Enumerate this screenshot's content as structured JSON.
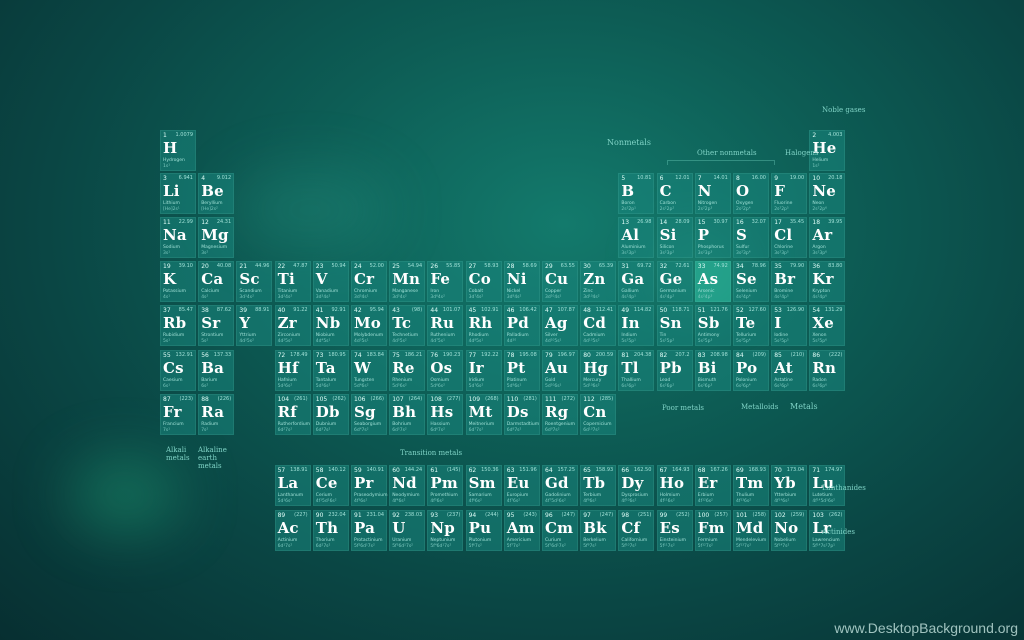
{
  "labels": {
    "nonmetals": "Nonmetals",
    "other_nonmetals": "Other nonmetals",
    "halogens": "Halogens",
    "noble_gases": "Noble gases",
    "transition_metals": "Transition metals",
    "poor_metals": "Poor metals",
    "metalloids": "Metalloids",
    "metals": "Metals",
    "alkali_metals": "Alkali metals",
    "alkaline_earth_metals": "Alkaline earth metals",
    "lanthanides": "Lanthanides",
    "actinides": "Actinides"
  },
  "watermark": "www.DesktopBackground.org",
  "elements": [
    {
      "n": "1",
      "s": "H",
      "name": "Hydrogen",
      "m": "1.0079",
      "c": "1s¹",
      "g": 1,
      "p": 1
    },
    {
      "n": "2",
      "s": "He",
      "name": "Helium",
      "m": "4.003",
      "c": "1s²",
      "g": 18,
      "p": 1
    },
    {
      "n": "3",
      "s": "Li",
      "name": "Lithium",
      "m": "6.941",
      "c": "[He]2s¹",
      "g": 1,
      "p": 2
    },
    {
      "n": "4",
      "s": "Be",
      "name": "Beryllium",
      "m": "9.012",
      "c": "[He]2s²",
      "g": 2,
      "p": 2
    },
    {
      "n": "5",
      "s": "B",
      "name": "Boron",
      "m": "10.81",
      "c": "2s²2p¹",
      "g": 13,
      "p": 2
    },
    {
      "n": "6",
      "s": "C",
      "name": "Carbon",
      "m": "12.01",
      "c": "2s²2p²",
      "g": 14,
      "p": 2
    },
    {
      "n": "7",
      "s": "N",
      "name": "Nitrogen",
      "m": "14.01",
      "c": "2s²2p³",
      "g": 15,
      "p": 2
    },
    {
      "n": "8",
      "s": "O",
      "name": "Oxygen",
      "m": "16.00",
      "c": "2s²2p⁴",
      "g": 16,
      "p": 2
    },
    {
      "n": "9",
      "s": "F",
      "name": "Fluorine",
      "m": "19.00",
      "c": "2s²2p⁵",
      "g": 17,
      "p": 2
    },
    {
      "n": "10",
      "s": "Ne",
      "name": "Neon",
      "m": "20.18",
      "c": "2s²2p⁶",
      "g": 18,
      "p": 2
    },
    {
      "n": "11",
      "s": "Na",
      "name": "Sodium",
      "m": "22.99",
      "c": "3s¹",
      "g": 1,
      "p": 3
    },
    {
      "n": "12",
      "s": "Mg",
      "name": "Magnesium",
      "m": "24.31",
      "c": "3s²",
      "g": 2,
      "p": 3
    },
    {
      "n": "13",
      "s": "Al",
      "name": "Aluminium",
      "m": "26.98",
      "c": "3s²3p¹",
      "g": 13,
      "p": 3
    },
    {
      "n": "14",
      "s": "Si",
      "name": "Silicon",
      "m": "28.09",
      "c": "3s²3p²",
      "g": 14,
      "p": 3
    },
    {
      "n": "15",
      "s": "P",
      "name": "Phosphorus",
      "m": "30.97",
      "c": "3s²3p³",
      "g": 15,
      "p": 3
    },
    {
      "n": "16",
      "s": "S",
      "name": "Sulfur",
      "m": "32.07",
      "c": "3s²3p⁴",
      "g": 16,
      "p": 3
    },
    {
      "n": "17",
      "s": "Cl",
      "name": "Chlorine",
      "m": "35.45",
      "c": "3s²3p⁵",
      "g": 17,
      "p": 3
    },
    {
      "n": "18",
      "s": "Ar",
      "name": "Argon",
      "m": "39.95",
      "c": "3s²3p⁶",
      "g": 18,
      "p": 3
    },
    {
      "n": "19",
      "s": "K",
      "name": "Potassium",
      "m": "39.10",
      "c": "4s¹",
      "g": 1,
      "p": 4
    },
    {
      "n": "20",
      "s": "Ca",
      "name": "Calcium",
      "m": "40.08",
      "c": "4s²",
      "g": 2,
      "p": 4
    },
    {
      "n": "21",
      "s": "Sc",
      "name": "Scandium",
      "m": "44.96",
      "c": "3d¹4s²",
      "g": 3,
      "p": 4
    },
    {
      "n": "22",
      "s": "Ti",
      "name": "Titanium",
      "m": "47.87",
      "c": "3d²4s²",
      "g": 4,
      "p": 4
    },
    {
      "n": "23",
      "s": "V",
      "name": "Vanadium",
      "m": "50.94",
      "c": "3d³4s²",
      "g": 5,
      "p": 4
    },
    {
      "n": "24",
      "s": "Cr",
      "name": "Chromium",
      "m": "52.00",
      "c": "3d⁵4s¹",
      "g": 6,
      "p": 4
    },
    {
      "n": "25",
      "s": "Mn",
      "name": "Manganese",
      "m": "54.94",
      "c": "3d⁵4s²",
      "g": 7,
      "p": 4
    },
    {
      "n": "26",
      "s": "Fe",
      "name": "Iron",
      "m": "55.85",
      "c": "3d⁶4s²",
      "g": 8,
      "p": 4
    },
    {
      "n": "27",
      "s": "Co",
      "name": "Cobalt",
      "m": "58.93",
      "c": "3d⁷4s²",
      "g": 9,
      "p": 4
    },
    {
      "n": "28",
      "s": "Ni",
      "name": "Nickel",
      "m": "58.69",
      "c": "3d⁸4s²",
      "g": 10,
      "p": 4
    },
    {
      "n": "29",
      "s": "Cu",
      "name": "Copper",
      "m": "63.55",
      "c": "3d¹⁰4s¹",
      "g": 11,
      "p": 4
    },
    {
      "n": "30",
      "s": "Zn",
      "name": "Zinc",
      "m": "65.39",
      "c": "3d¹⁰4s²",
      "g": 12,
      "p": 4
    },
    {
      "n": "31",
      "s": "Ga",
      "name": "Gallium",
      "m": "69.72",
      "c": "4s²4p¹",
      "g": 13,
      "p": 4
    },
    {
      "n": "32",
      "s": "Ge",
      "name": "Germanium",
      "m": "72.61",
      "c": "4s²4p²",
      "g": 14,
      "p": 4
    },
    {
      "n": "33",
      "s": "As",
      "name": "Arsenic",
      "m": "74.92",
      "c": "4s²4p³",
      "g": 15,
      "p": 4,
      "hl": true
    },
    {
      "n": "34",
      "s": "Se",
      "name": "Selenium",
      "m": "78.96",
      "c": "4s²4p⁴",
      "g": 16,
      "p": 4
    },
    {
      "n": "35",
      "s": "Br",
      "name": "Bromine",
      "m": "79.90",
      "c": "4s²4p⁵",
      "g": 17,
      "p": 4
    },
    {
      "n": "36",
      "s": "Kr",
      "name": "Krypton",
      "m": "83.80",
      "c": "4s²4p⁶",
      "g": 18,
      "p": 4
    },
    {
      "n": "37",
      "s": "Rb",
      "name": "Rubidium",
      "m": "85.47",
      "c": "5s¹",
      "g": 1,
      "p": 5
    },
    {
      "n": "38",
      "s": "Sr",
      "name": "Strontium",
      "m": "87.62",
      "c": "5s²",
      "g": 2,
      "p": 5
    },
    {
      "n": "39",
      "s": "Y",
      "name": "Yttrium",
      "m": "88.91",
      "c": "4d¹5s²",
      "g": 3,
      "p": 5
    },
    {
      "n": "40",
      "s": "Zr",
      "name": "Zirconium",
      "m": "91.22",
      "c": "4d²5s²",
      "g": 4,
      "p": 5
    },
    {
      "n": "41",
      "s": "Nb",
      "name": "Niobium",
      "m": "92.91",
      "c": "4d⁴5s¹",
      "g": 5,
      "p": 5
    },
    {
      "n": "42",
      "s": "Mo",
      "name": "Molybdenum",
      "m": "95.94",
      "c": "4d⁵5s¹",
      "g": 6,
      "p": 5
    },
    {
      "n": "43",
      "s": "Tc",
      "name": "Technetium",
      "m": "(98)",
      "c": "4d⁵5s²",
      "g": 7,
      "p": 5
    },
    {
      "n": "44",
      "s": "Ru",
      "name": "Ruthenium",
      "m": "101.07",
      "c": "4d⁷5s¹",
      "g": 8,
      "p": 5
    },
    {
      "n": "45",
      "s": "Rh",
      "name": "Rhodium",
      "m": "102.91",
      "c": "4d⁸5s¹",
      "g": 9,
      "p": 5
    },
    {
      "n": "46",
      "s": "Pd",
      "name": "Palladium",
      "m": "106.42",
      "c": "4d¹⁰",
      "g": 10,
      "p": 5
    },
    {
      "n": "47",
      "s": "Ag",
      "name": "Silver",
      "m": "107.87",
      "c": "4d¹⁰5s¹",
      "g": 11,
      "p": 5
    },
    {
      "n": "48",
      "s": "Cd",
      "name": "Cadmium",
      "m": "112.41",
      "c": "4d¹⁰5s²",
      "g": 12,
      "p": 5
    },
    {
      "n": "49",
      "s": "In",
      "name": "Indium",
      "m": "114.82",
      "c": "5s²5p¹",
      "g": 13,
      "p": 5
    },
    {
      "n": "50",
      "s": "Sn",
      "name": "Tin",
      "m": "118.71",
      "c": "5s²5p²",
      "g": 14,
      "p": 5
    },
    {
      "n": "51",
      "s": "Sb",
      "name": "Antimony",
      "m": "121.76",
      "c": "5s²5p³",
      "g": 15,
      "p": 5
    },
    {
      "n": "52",
      "s": "Te",
      "name": "Tellurium",
      "m": "127.60",
      "c": "5s²5p⁴",
      "g": 16,
      "p": 5
    },
    {
      "n": "53",
      "s": "I",
      "name": "Iodine",
      "m": "126.90",
      "c": "5s²5p⁵",
      "g": 17,
      "p": 5
    },
    {
      "n": "54",
      "s": "Xe",
      "name": "Xenon",
      "m": "131.29",
      "c": "5s²5p⁶",
      "g": 18,
      "p": 5
    },
    {
      "n": "55",
      "s": "Cs",
      "name": "Caesium",
      "m": "132.91",
      "c": "6s¹",
      "g": 1,
      "p": 6
    },
    {
      "n": "56",
      "s": "Ba",
      "name": "Barium",
      "m": "137.33",
      "c": "6s²",
      "g": 2,
      "p": 6
    },
    {
      "n": "72",
      "s": "Hf",
      "name": "Hafnium",
      "m": "178.49",
      "c": "5d²6s²",
      "g": 4,
      "p": 6
    },
    {
      "n": "73",
      "s": "Ta",
      "name": "Tantalum",
      "m": "180.95",
      "c": "5d³6s²",
      "g": 5,
      "p": 6
    },
    {
      "n": "74",
      "s": "W",
      "name": "Tungsten",
      "m": "183.84",
      "c": "5d⁴6s²",
      "g": 6,
      "p": 6
    },
    {
      "n": "75",
      "s": "Re",
      "name": "Rhenium",
      "m": "186.21",
      "c": "5d⁵6s²",
      "g": 7,
      "p": 6
    },
    {
      "n": "76",
      "s": "Os",
      "name": "Osmium",
      "m": "190.23",
      "c": "5d⁶6s²",
      "g": 8,
      "p": 6
    },
    {
      "n": "77",
      "s": "Ir",
      "name": "Iridium",
      "m": "192.22",
      "c": "5d⁷6s²",
      "g": 9,
      "p": 6
    },
    {
      "n": "78",
      "s": "Pt",
      "name": "Platinum",
      "m": "195.08",
      "c": "5d⁹6s¹",
      "g": 10,
      "p": 6
    },
    {
      "n": "79",
      "s": "Au",
      "name": "Gold",
      "m": "196.97",
      "c": "5d¹⁰6s¹",
      "g": 11,
      "p": 6
    },
    {
      "n": "80",
      "s": "Hg",
      "name": "Mercury",
      "m": "200.59",
      "c": "5d¹⁰6s²",
      "g": 12,
      "p": 6
    },
    {
      "n": "81",
      "s": "Tl",
      "name": "Thallium",
      "m": "204.38",
      "c": "6s²6p¹",
      "g": 13,
      "p": 6
    },
    {
      "n": "82",
      "s": "Pb",
      "name": "Lead",
      "m": "207.2",
      "c": "6s²6p²",
      "g": 14,
      "p": 6
    },
    {
      "n": "83",
      "s": "Bi",
      "name": "Bismuth",
      "m": "208.98",
      "c": "6s²6p³",
      "g": 15,
      "p": 6
    },
    {
      "n": "84",
      "s": "Po",
      "name": "Polonium",
      "m": "(209)",
      "c": "6s²6p⁴",
      "g": 16,
      "p": 6
    },
    {
      "n": "85",
      "s": "At",
      "name": "Astatine",
      "m": "(210)",
      "c": "6s²6p⁵",
      "g": 17,
      "p": 6
    },
    {
      "n": "86",
      "s": "Rn",
      "name": "Radon",
      "m": "(222)",
      "c": "6s²6p⁶",
      "g": 18,
      "p": 6
    },
    {
      "n": "87",
      "s": "Fr",
      "name": "Francium",
      "m": "(223)",
      "c": "7s¹",
      "g": 1,
      "p": 7
    },
    {
      "n": "88",
      "s": "Ra",
      "name": "Radium",
      "m": "(226)",
      "c": "7s²",
      "g": 2,
      "p": 7
    },
    {
      "n": "104",
      "s": "Rf",
      "name": "Rutherfordium",
      "m": "(261)",
      "c": "6d²7s²",
      "g": 4,
      "p": 7
    },
    {
      "n": "105",
      "s": "Db",
      "name": "Dubnium",
      "m": "(262)",
      "c": "6d³7s²",
      "g": 5,
      "p": 7
    },
    {
      "n": "106",
      "s": "Sg",
      "name": "Seaborgium",
      "m": "(266)",
      "c": "6d⁴7s²",
      "g": 6,
      "p": 7
    },
    {
      "n": "107",
      "s": "Bh",
      "name": "Bohrium",
      "m": "(264)",
      "c": "6d⁵7s²",
      "g": 7,
      "p": 7
    },
    {
      "n": "108",
      "s": "Hs",
      "name": "Hassium",
      "m": "(277)",
      "c": "6d⁶7s²",
      "g": 8,
      "p": 7
    },
    {
      "n": "109",
      "s": "Mt",
      "name": "Meitnerium",
      "m": "(268)",
      "c": "6d⁷7s²",
      "g": 9,
      "p": 7
    },
    {
      "n": "110",
      "s": "Ds",
      "name": "Darmstadtium",
      "m": "(281)",
      "c": "6d⁸7s²",
      "g": 10,
      "p": 7
    },
    {
      "n": "111",
      "s": "Rg",
      "name": "Roentgenium",
      "m": "(272)",
      "c": "6d⁹7s²",
      "g": 11,
      "p": 7
    },
    {
      "n": "112",
      "s": "Cn",
      "name": "Copernicium",
      "m": "(285)",
      "c": "6d¹⁰7s²",
      "g": 12,
      "p": 7
    },
    {
      "n": "57",
      "s": "La",
      "name": "Lanthanum",
      "m": "138.91",
      "c": "5d¹6s²",
      "g": 4,
      "p": 9
    },
    {
      "n": "58",
      "s": "Ce",
      "name": "Cerium",
      "m": "140.12",
      "c": "4f¹5d¹6s²",
      "g": 5,
      "p": 9
    },
    {
      "n": "59",
      "s": "Pr",
      "name": "Praseodymium",
      "m": "140.91",
      "c": "4f³6s²",
      "g": 6,
      "p": 9
    },
    {
      "n": "60",
      "s": "Nd",
      "name": "Neodymium",
      "m": "144.24",
      "c": "4f⁴6s²",
      "g": 7,
      "p": 9
    },
    {
      "n": "61",
      "s": "Pm",
      "name": "Promethium",
      "m": "(145)",
      "c": "4f⁵6s²",
      "g": 8,
      "p": 9
    },
    {
      "n": "62",
      "s": "Sm",
      "name": "Samarium",
      "m": "150.36",
      "c": "4f⁶6s²",
      "g": 9,
      "p": 9
    },
    {
      "n": "63",
      "s": "Eu",
      "name": "Europium",
      "m": "151.96",
      "c": "4f⁷6s²",
      "g": 10,
      "p": 9
    },
    {
      "n": "64",
      "s": "Gd",
      "name": "Gadolinium",
      "m": "157.25",
      "c": "4f⁷5d¹6s²",
      "g": 11,
      "p": 9
    },
    {
      "n": "65",
      "s": "Tb",
      "name": "Terbium",
      "m": "158.93",
      "c": "4f⁹6s²",
      "g": 12,
      "p": 9
    },
    {
      "n": "66",
      "s": "Dy",
      "name": "Dysprosium",
      "m": "162.50",
      "c": "4f¹⁰6s²",
      "g": 13,
      "p": 9
    },
    {
      "n": "67",
      "s": "Ho",
      "name": "Holmium",
      "m": "164.93",
      "c": "4f¹¹6s²",
      "g": 14,
      "p": 9
    },
    {
      "n": "68",
      "s": "Er",
      "name": "Erbium",
      "m": "167.26",
      "c": "4f¹²6s²",
      "g": 15,
      "p": 9
    },
    {
      "n": "69",
      "s": "Tm",
      "name": "Thulium",
      "m": "168.93",
      "c": "4f¹³6s²",
      "g": 16,
      "p": 9
    },
    {
      "n": "70",
      "s": "Yb",
      "name": "Ytterbium",
      "m": "173.04",
      "c": "4f¹⁴6s²",
      "g": 17,
      "p": 9
    },
    {
      "n": "71",
      "s": "Lu",
      "name": "Lutetium",
      "m": "174.97",
      "c": "4f¹⁴5d¹6s²",
      "g": 18,
      "p": 9
    },
    {
      "n": "89",
      "s": "Ac",
      "name": "Actinium",
      "m": "(227)",
      "c": "6d¹7s²",
      "g": 4,
      "p": 10
    },
    {
      "n": "90",
      "s": "Th",
      "name": "Thorium",
      "m": "232.04",
      "c": "6d²7s²",
      "g": 5,
      "p": 10
    },
    {
      "n": "91",
      "s": "Pa",
      "name": "Protactinium",
      "m": "231.04",
      "c": "5f²6d¹7s²",
      "g": 6,
      "p": 10
    },
    {
      "n": "92",
      "s": "U",
      "name": "Uranium",
      "m": "238.03",
      "c": "5f³6d¹7s²",
      "g": 7,
      "p": 10
    },
    {
      "n": "93",
      "s": "Np",
      "name": "Neptunium",
      "m": "(237)",
      "c": "5f⁴6d¹7s²",
      "g": 8,
      "p": 10
    },
    {
      "n": "94",
      "s": "Pu",
      "name": "Plutonium",
      "m": "(244)",
      "c": "5f⁶7s²",
      "g": 9,
      "p": 10
    },
    {
      "n": "95",
      "s": "Am",
      "name": "Americium",
      "m": "(243)",
      "c": "5f⁷7s²",
      "g": 10,
      "p": 10
    },
    {
      "n": "96",
      "s": "Cm",
      "name": "Curium",
      "m": "(247)",
      "c": "5f⁷6d¹7s²",
      "g": 11,
      "p": 10
    },
    {
      "n": "97",
      "s": "Bk",
      "name": "Berkelium",
      "m": "(247)",
      "c": "5f⁹7s²",
      "g": 12,
      "p": 10
    },
    {
      "n": "98",
      "s": "Cf",
      "name": "Californium",
      "m": "(251)",
      "c": "5f¹⁰7s²",
      "g": 13,
      "p": 10
    },
    {
      "n": "99",
      "s": "Es",
      "name": "Einsteinium",
      "m": "(252)",
      "c": "5f¹¹7s²",
      "g": 14,
      "p": 10
    },
    {
      "n": "100",
      "s": "Fm",
      "name": "Fermium",
      "m": "(257)",
      "c": "5f¹²7s²",
      "g": 15,
      "p": 10
    },
    {
      "n": "101",
      "s": "Md",
      "name": "Mendelevium",
      "m": "(258)",
      "c": "5f¹³7s²",
      "g": 16,
      "p": 10
    },
    {
      "n": "102",
      "s": "No",
      "name": "Nobelium",
      "m": "(259)",
      "c": "5f¹⁴7s²",
      "g": 17,
      "p": 10
    },
    {
      "n": "103",
      "s": "Lr",
      "name": "Lawrencium",
      "m": "(262)",
      "c": "5f¹⁴7s²7p¹",
      "g": 18,
      "p": 10
    }
  ]
}
